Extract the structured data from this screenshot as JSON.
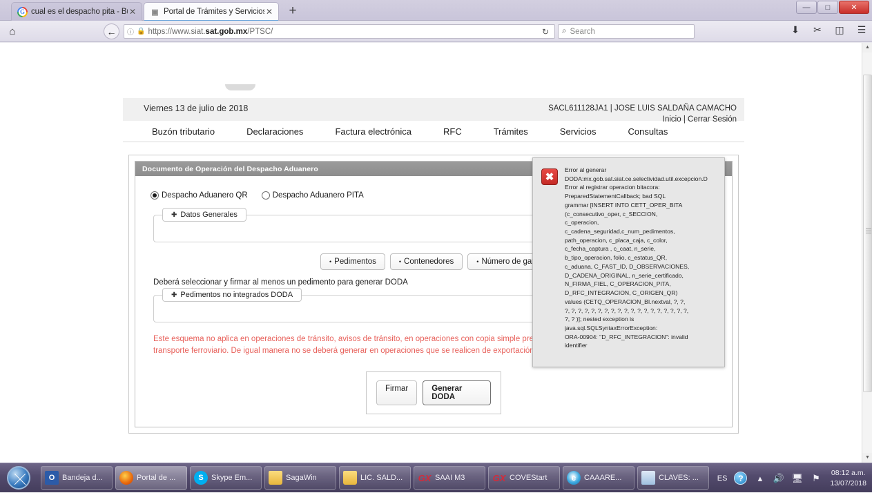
{
  "browser": {
    "tabs": [
      {
        "label": "cual es el despacho pita - Bu",
        "favicon": "google-icon",
        "close": "✕"
      },
      {
        "label": "Portal de Trámites y Servicios a",
        "favicon": "document-icon",
        "close": "✕"
      }
    ],
    "new_tab_label": "+",
    "window_buttons": {
      "minimize": "—",
      "maximize": "□",
      "close": "✕"
    },
    "home_icon": "⌂",
    "back_icon": "←",
    "url_info_icon": "ⓘ",
    "url_lock_icon": "▮",
    "url_prefix": "https://www.siat.",
    "url_domain": "sat.gob.mx",
    "url_suffix": "/PTSC/",
    "reload_icon": "↻",
    "search_icon": "⌕",
    "search_placeholder": "Search",
    "toolbar_icons": [
      "download-icon",
      "pocket-icon",
      "sidebar-icon",
      "menu-icon"
    ],
    "scrollbar": {
      "up": "▲",
      "down": "▼"
    }
  },
  "sat": {
    "date": "Viernes 13 de julio de 2018",
    "rfc_user": "SACL611128JA1  |  JOSE LUIS SALDAÑA CAMACHO",
    "link_inicio": "Inicio",
    "link_sep": "|",
    "link_cerrar": "Cerrar Sesión",
    "menu": [
      "Buzón tributario",
      "Declaraciones",
      "Factura electrónica",
      "RFC",
      "Trámites",
      "Servicios",
      "Consultas"
    ],
    "panel_title": "Documento de Operación del Despacho Aduanero",
    "radio_qr": "Despacho Aduanero QR",
    "radio_pita": "Despacho Aduanero PITA",
    "fieldset_datos_generales": "Datos Generales",
    "fieldset_pedimentos_no_integrados": "Pedimentos no integrados DODA",
    "accordion_buttons": [
      "Pedimentos",
      "Contenedores",
      "Número de gafete único"
    ],
    "hint": "Deberá seleccionar y firmar al menos un pedimento para generar DODA",
    "warning": "Este esquema no aplica en operaciones de tránsito, avisos de tránsito, en operaciones con copia simple previa, y operaciones por medio de transporte ferroviario. De igual manera no se deberá generar en operaciones que se realicen de exportación.",
    "btn_firmar": "Firmar",
    "btn_generar": "Generar DODA",
    "plus_glyph": "✚",
    "dot_glyph": "•"
  },
  "dialog": {
    "icon": "✖",
    "lines": [
      "Error al generar",
      "DODA:mx.gob.sat.siat.ce.selectividad.util.excepcion.D",
      "Error al registrar operacion bitacora:",
      "PreparedStatementCallback; bad SQL",
      "grammar [INSERT INTO CETT_OPER_BITA",
      "(c_consecutivo_oper, c_SECCION,",
      "c_operacion,",
      "c_cadena_seguridad,c_num_pedimentos,",
      "path_operacion, c_placa_caja, c_color,",
      "c_fecha_captura , c_caat, n_serie,",
      "b_tipo_operacion, folio, c_estatus_QR,",
      "c_aduana, C_FAST_ID, D_OBSERVACIONES,",
      "D_CADENA_ORIGINAL, n_serie_certificado,",
      "N_FIRMA_FIEL, C_OPERACION_PITA,",
      "D_RFC_INTEGRACION, C_ORIGEN_QR)",
      "values (CETQ_OPERACION_BI.nextval, ?, ?,",
      "?, ?, ?, ?, ?, ?, ?, ?, ?, ?, ?, ?, ?, ?, ?, ?, ?, ?, ?,",
      "?, ? )]; nested exception is",
      "java.sql.SQLSyntaxErrorException:",
      "ORA-00904: \"D_RFC_INTEGRACION\": invalid",
      "identifier"
    ]
  },
  "taskbar": {
    "start_label": "start-orb",
    "items": [
      {
        "label": "Bandeja d...",
        "icon": "outlook-icon"
      },
      {
        "label": "Portal de ...",
        "icon": "firefox-icon",
        "active": true
      },
      {
        "label": "Skype Em...",
        "icon": "skype-icon"
      },
      {
        "label": "SagaWin",
        "icon": "folder-icon"
      },
      {
        "label": "LIC. SALD...",
        "icon": "folder-icon"
      },
      {
        "label": "SAAI M3",
        "icon": "genexus-icon"
      },
      {
        "label": "COVEStart",
        "icon": "genexus-icon"
      },
      {
        "label": "CAAARE...",
        "icon": "internet-explorer-icon"
      },
      {
        "label": "CLAVES: ...",
        "icon": "claves-icon"
      }
    ],
    "language": "ES",
    "help_icon": "?",
    "show_hidden_icon": "▴",
    "volume_icon": "◂))",
    "network_icon": "☰",
    "flag_icon": "⚑",
    "time": "08:12 a.m.",
    "date": "13/07/2018"
  }
}
